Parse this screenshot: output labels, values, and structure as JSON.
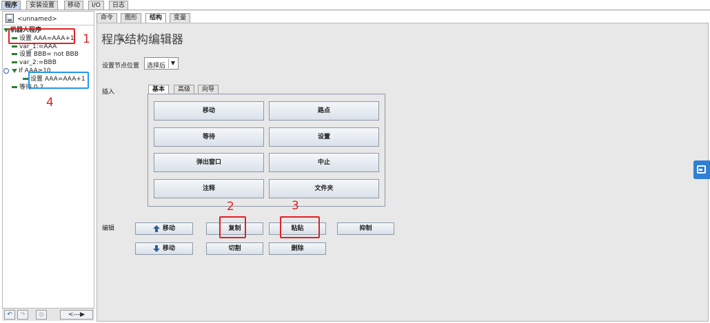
{
  "top_tabs": [
    "程序",
    "安装设置",
    "移动",
    "I/O",
    "日志"
  ],
  "program": {
    "name": "<unnamed>",
    "root_label": "机器人程序",
    "nodes": [
      "设置 AAA=AAA+1",
      "var_1:=AAA",
      "设置 BBB= not BBB",
      "var_2:=BBB",
      "If AAA≥10",
      "设置 AAA=AAA+1",
      "等待 0.2"
    ]
  },
  "bottom_bar": {
    "nav_label": "<---▶"
  },
  "sub_tabs": [
    "命令",
    "图形",
    "结构",
    "变量"
  ],
  "editor": {
    "title": "程序结构编辑器",
    "node_position_label": "设置节点位置",
    "node_position_value": "选择后",
    "insert_label": "插入",
    "insert_tabs": [
      "基本",
      "高级",
      "向导"
    ],
    "insert_buttons": [
      "移动",
      "路点",
      "等待",
      "设置",
      "弹出窗口",
      "中止",
      "注释",
      "文件夹"
    ],
    "edit_label": "编辑",
    "edit_buttons": {
      "move_up": "移动",
      "copy": "复制",
      "paste": "粘贴",
      "suppress": "抑制",
      "move_down": "移动",
      "cut": "切割",
      "delete": "删除"
    }
  },
  "annotations": [
    "1",
    "2",
    "3",
    "4"
  ],
  "colors": {
    "annotation_red": "#e02020",
    "annotation_blue": "#2196f3",
    "node_green": "#2e7d32",
    "side_button": "#2f7fd4"
  }
}
